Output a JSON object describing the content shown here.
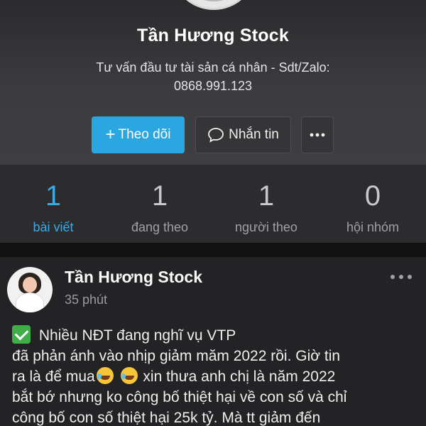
{
  "profile": {
    "name": "Tần Hương Stock",
    "bio_line1": "Tư vấn đầu tư tài sản cá nhân - Sdt/Zalo:",
    "bio_line2": "0868.991.123"
  },
  "actions": {
    "follow_label": "Theo dõi",
    "message_label": "Nhắn tin",
    "more_icon": "ellipsis-icon"
  },
  "stats": [
    {
      "value": "1",
      "label": "bài viết"
    },
    {
      "value": "1",
      "label": "đang theo"
    },
    {
      "value": "1",
      "label": "người theo"
    },
    {
      "value": "0",
      "label": "hội nhóm"
    }
  ],
  "post": {
    "author": "Tần Hương Stock",
    "time": "35 phút",
    "lines": [
      "Nhiều NĐT đang nghĩ vụ VTP",
      "đã phản ánh vào nhịp giảm măm 2022 rồi. Giờ tin",
      "ra là để mua",
      "xin thưa anh chị là  năm 2022",
      "bắt bớ nhưng ko công bố thiệt hại về con số và chỉ",
      "công bố con số thiệt hại  25k tỷ. Mà tt giảm đến"
    ]
  },
  "colors": {
    "accent": "#2aa6e0",
    "active_stat": "#3fa9e6",
    "background": "#111112"
  }
}
